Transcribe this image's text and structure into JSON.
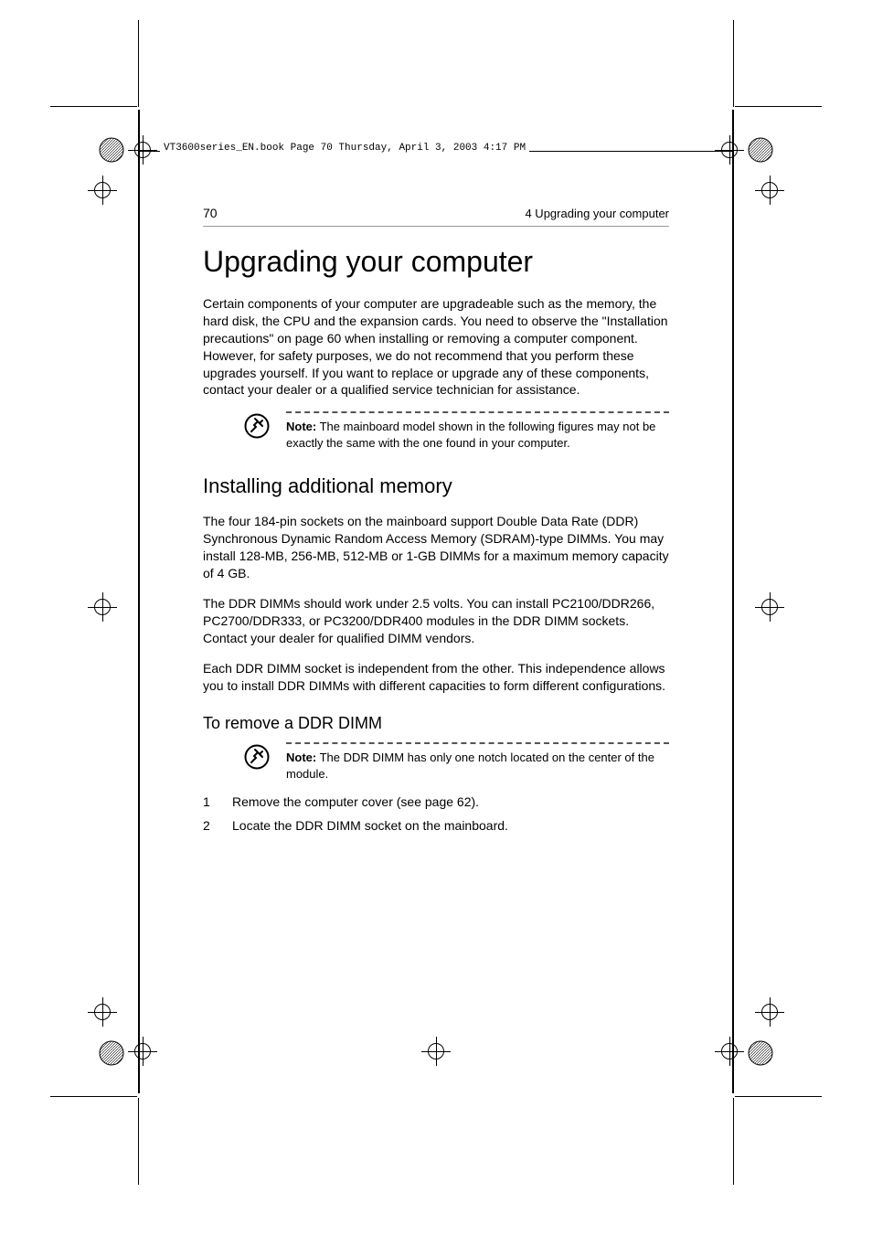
{
  "printer_header": "VT3600series_EN.book  Page 70  Thursday, April 3, 2003  4:17 PM",
  "page_number": "70",
  "chapter_header": "4 Upgrading your computer",
  "title": "Upgrading your computer",
  "intro_paragraph": "Certain components of your computer are upgradeable such as the memory, the hard disk, the CPU and the expansion cards.  You need to observe the \"Installation precautions\" on page 60 when installing or removing a computer component.  However, for safety purposes, we do not recommend that you perform these upgrades yourself.  If you want to replace or upgrade any of these components, contact your dealer or a qualified service technician for assistance.",
  "note1": {
    "label": "Note:",
    "text": "  The mainboard model shown in the following figures may not be exactly the same with the one found in your computer."
  },
  "section1_heading": "Installing additional memory",
  "section1_p1": "The four 184-pin sockets on the mainboard support Double Data Rate (DDR) Synchronous Dynamic Random Access Memory (SDRAM)-type DIMMs.  You may install 128-MB, 256-MB, 512-MB or 1-GB DIMMs for a maximum memory capacity of 4 GB.",
  "section1_p2": "The DDR DIMMs should work under 2.5 volts.  You can install PC2100/DDR266, PC2700/DDR333, or PC3200/DDR400 modules in the DDR DIMM sockets. Contact your dealer for qualified DIMM vendors.",
  "section1_p3": "Each DDR DIMM socket is independent from the other.  This independence allows you to install DDR DIMMs with different capacities to form different configurations.",
  "section2_heading": "To remove a DDR DIMM",
  "note2": {
    "label": "Note:",
    "text": "  The DDR DIMM has only one notch located on the center of the module."
  },
  "steps": [
    {
      "num": "1",
      "text": "Remove the computer cover (see page 62)."
    },
    {
      "num": "2",
      "text": "Locate the DDR DIMM socket on the mainboard."
    }
  ]
}
